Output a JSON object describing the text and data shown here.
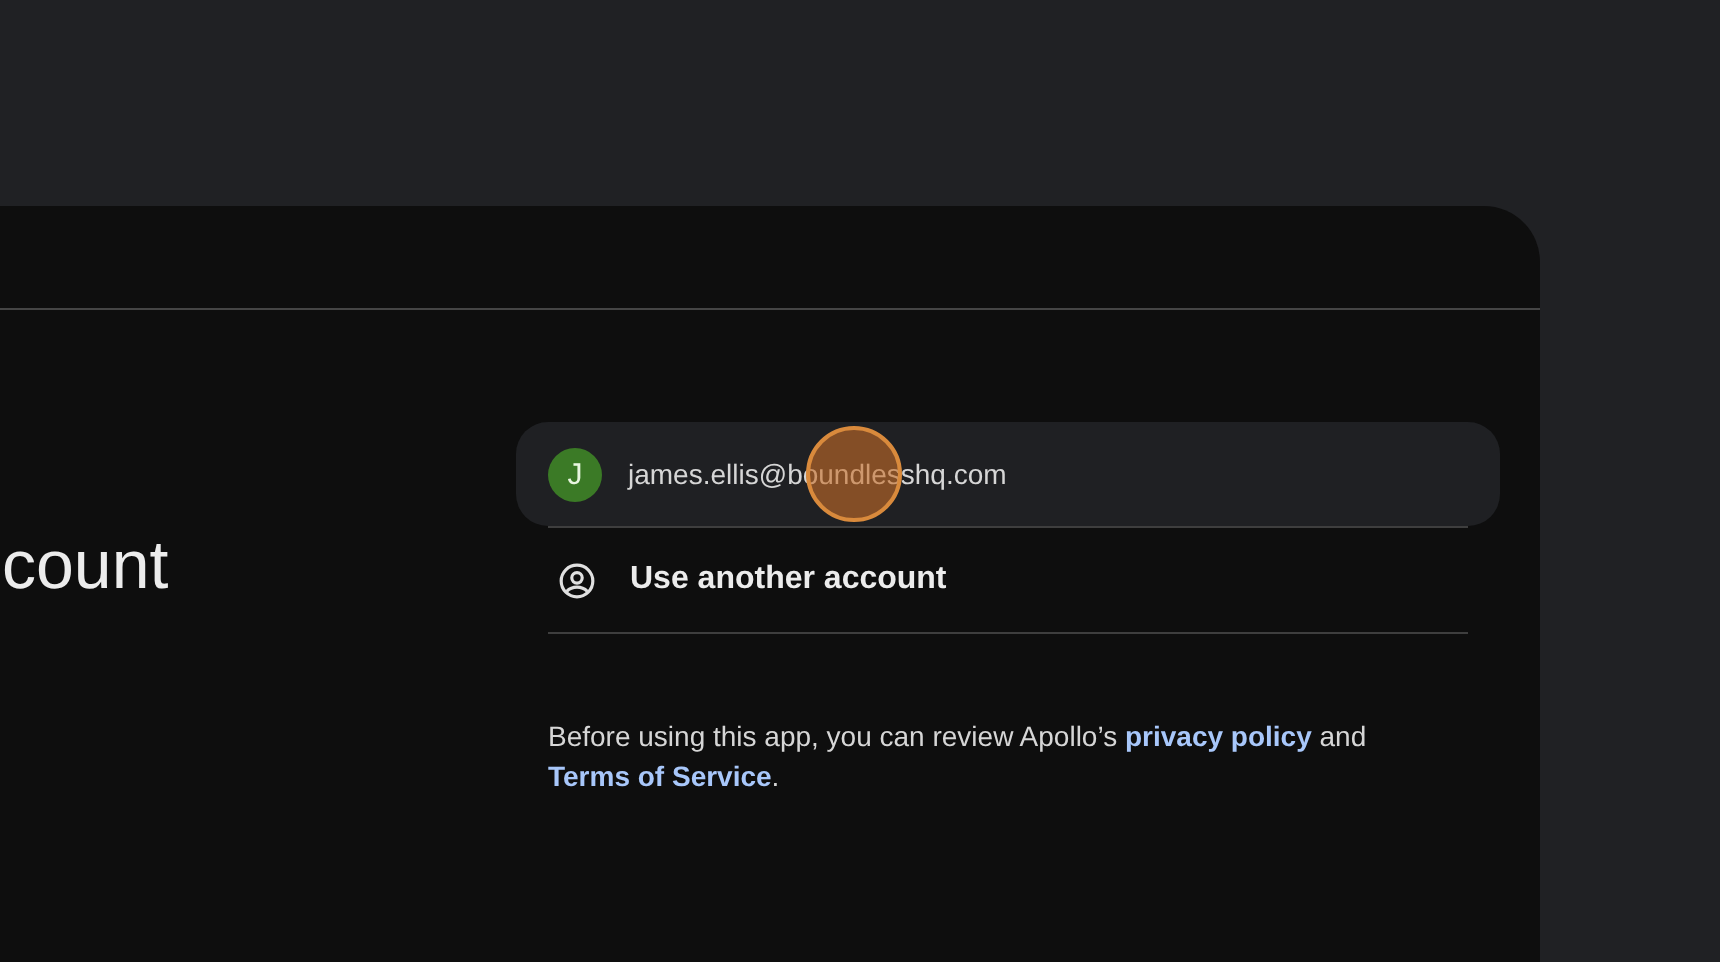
{
  "heading": "count",
  "accounts": [
    {
      "initial": "J",
      "email": "james.ellis@boundlesshq.com",
      "selected": true
    }
  ],
  "other_account": {
    "label": "Use another account"
  },
  "disclaimer": {
    "before": "Before using this app, you can review Apollo’s",
    "privacy_link": "privacy policy",
    "between": "and",
    "terms_link": "Terms of Service",
    "after": "."
  }
}
